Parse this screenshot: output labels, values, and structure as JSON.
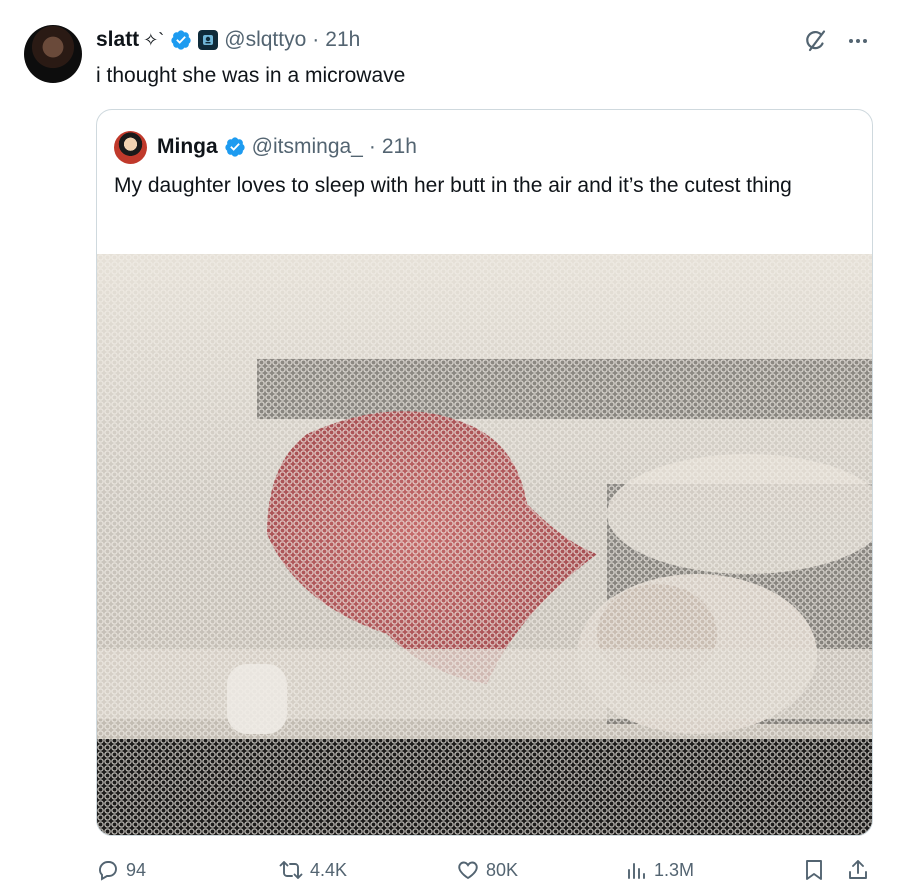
{
  "tweet": {
    "display_name": "slatt",
    "name_emoji": "✧`",
    "handle": "@slqttyo",
    "separator": "·",
    "time": "21h",
    "text": "i thought she was in a microwave"
  },
  "quote": {
    "display_name": "Minga",
    "handle": "@itsminga_",
    "separator": "·",
    "time": "21h",
    "text": "My daughter loves to sleep with her butt in the air and it’s the cutest thing"
  },
  "actions": {
    "replies": "94",
    "retweets": "4.4K",
    "likes": "80K",
    "views": "1.3M"
  },
  "colors": {
    "verified": "#1d9bf0",
    "muted": "#536471",
    "text": "#0f1419",
    "border": "#cfd9de"
  },
  "icons": [
    "grok-icon",
    "more-icon",
    "verified-badge-icon",
    "affiliate-badge-icon",
    "reply-icon",
    "retweet-icon",
    "like-icon",
    "views-icon",
    "bookmark-icon",
    "share-icon"
  ]
}
